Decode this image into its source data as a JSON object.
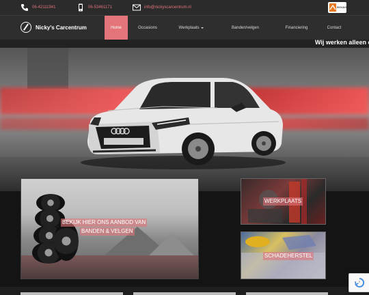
{
  "contact": {
    "phone": "06-42111941",
    "mobile": "06-53461171",
    "email": "info@nickyscarcentrum.nl"
  },
  "badge": {
    "text": "BOVAG"
  },
  "logo": {
    "name": "Nicky's Carcentrum"
  },
  "nav": {
    "home": "Home",
    "occasions": "Occasions",
    "werkplaats": "Werkplaats",
    "banden": "Banden/velgen",
    "financiering": "Financiering",
    "contact": "Contact"
  },
  "marquee": {
    "text": "Wij werken alleen o"
  },
  "tiles": {
    "banden_line1": "BEKIJK HIER ONS AANBOD VAN",
    "banden_line2": "BANDEN & VELGEN",
    "werkplaats": "WERKPLAATS",
    "schadeherstel": "SCHADEHERSTEL"
  },
  "colors": {
    "accent": "#e2747a",
    "nav_bg": "#2e2e2e",
    "topbar_bg": "#2b2b2b"
  },
  "icons": {
    "phone": "phone-icon",
    "mobile": "mobile-icon",
    "email": "envelope-icon",
    "logo": "logo-icon",
    "recaptcha": "recaptcha-icon"
  }
}
